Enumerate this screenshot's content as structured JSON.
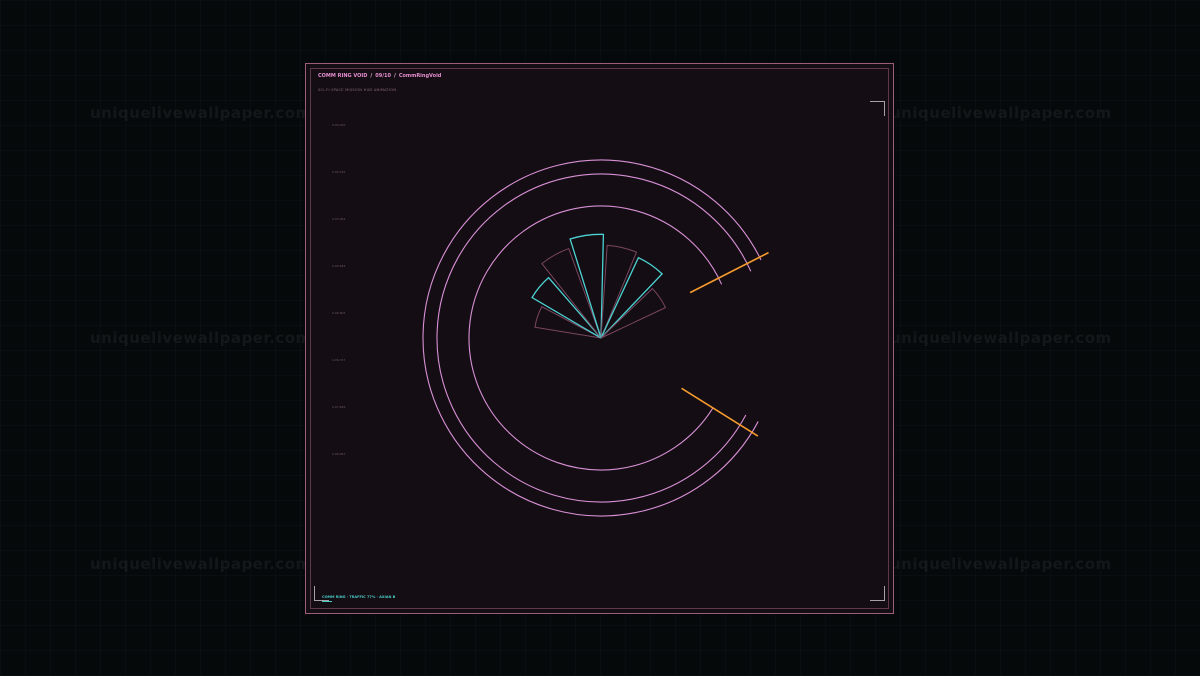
{
  "watermark": {
    "text": "uniquelivewallpaper.com"
  },
  "card": {
    "title_name": "COMM RING VOID",
    "title_index": "09/10",
    "title_id": "CommRingVoid",
    "subtitle": "SCI-FI SPACE MISSION HUD ANIMATION",
    "y_ticks": [
      "0.00.000",
      "0.02.245",
      "0.03.364",
      "0.04.484",
      "0.05.605",
      "0.06.727",
      "0.07.846",
      "0.08.967"
    ],
    "footer_label": "COMM RING · TRAFFIC 77% · AXIAN B",
    "colors": {
      "ring": "#d890d6",
      "cyan": "#4cd3d3",
      "muted": "#7b4760",
      "orange": "#f39a2e",
      "frame": "#9c5d78"
    },
    "fan_levels": [
      0.62,
      0.74,
      0.88,
      0.96,
      0.86,
      0.82,
      0.66
    ],
    "fan_highlight": [
      false,
      true,
      false,
      true,
      false,
      true,
      false
    ]
  }
}
